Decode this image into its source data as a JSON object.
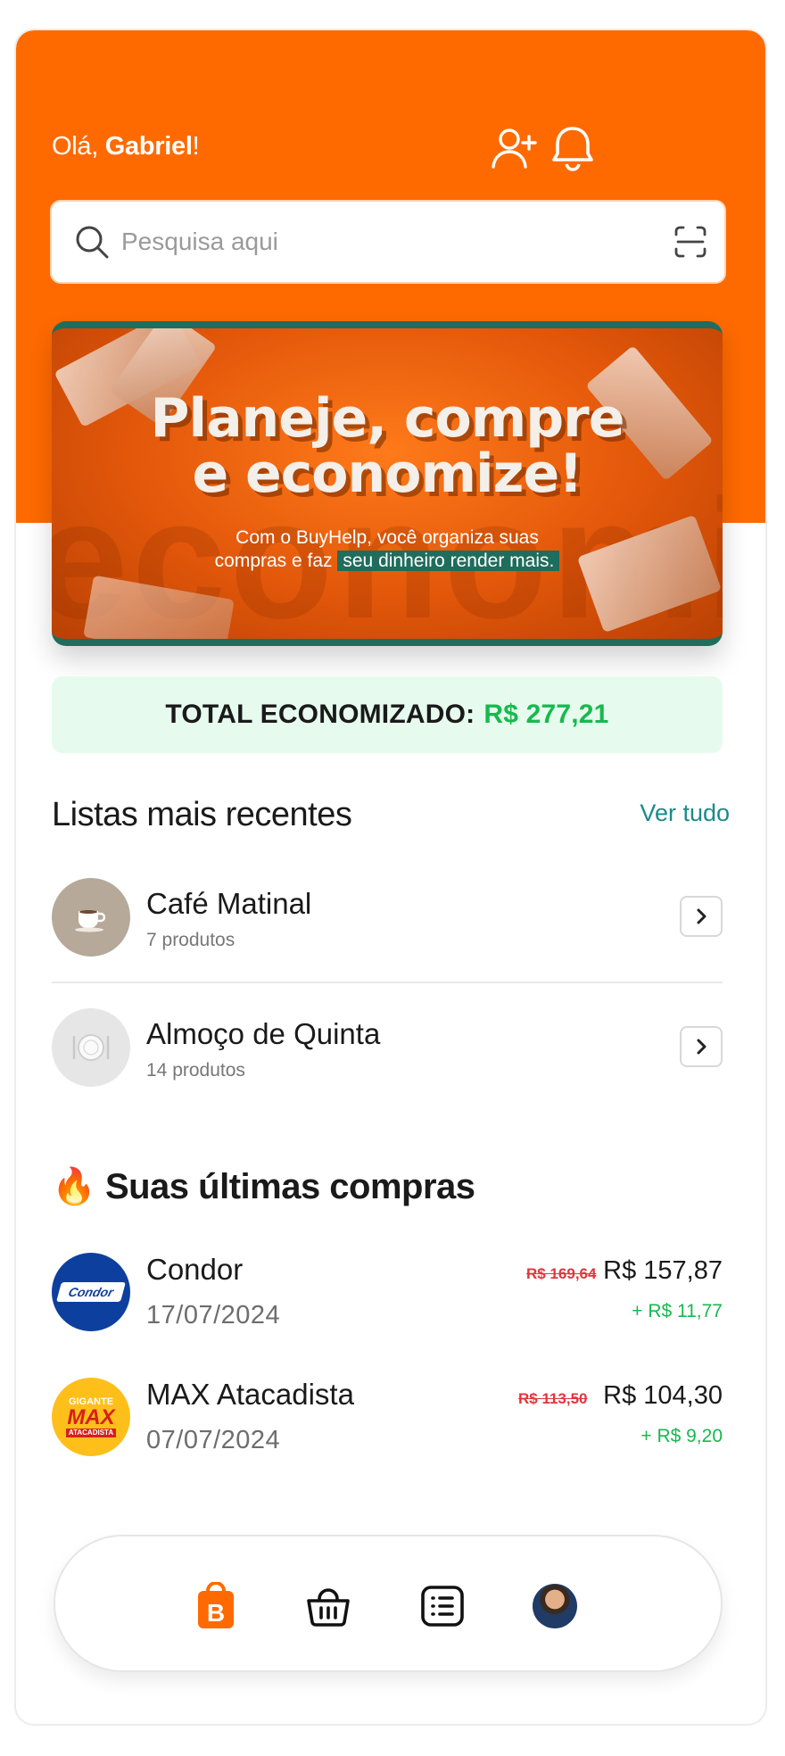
{
  "header": {
    "greeting_prefix": "Olá, ",
    "user_name": "Gabriel",
    "greeting_suffix": "!"
  },
  "search": {
    "placeholder": "Pesquisa aqui"
  },
  "banner": {
    "title_line1": "Planeje, compre",
    "title_line2": "e economize!",
    "subtitle_line1": "Com o BuyHelp, você organiza suas",
    "subtitle_line2_start": "compras e faz ",
    "subtitle_highlight": "seu dinheiro render mais.",
    "background_word": "economize"
  },
  "total": {
    "label": "TOTAL ECONOMIZADO:",
    "amount": "R$ 277,21"
  },
  "recent_lists": {
    "title": "Listas mais recentes",
    "see_all": "Ver tudo",
    "items": [
      {
        "name": "Café Matinal",
        "count": "7 produtos",
        "icon": "coffee-cup-icon"
      },
      {
        "name": "Almoço de Quinta",
        "count": "14 produtos",
        "icon": "plate-icon"
      }
    ]
  },
  "purchases": {
    "title_emoji": "🔥",
    "title": "Suas últimas compras",
    "items": [
      {
        "store": "Condor",
        "date": "17/07/2024",
        "old_price": "R$ 169,64",
        "price": "R$ 157,87",
        "saved": "+ R$ 11,77",
        "logo_text": "Condor"
      },
      {
        "store": "MAX Atacadista",
        "date": "07/07/2024",
        "old_price": "R$ 113,50",
        "price": "R$ 104,30",
        "saved": "+ R$ 9,20",
        "logo_top": "GIGANTE",
        "logo_main": "MAX",
        "logo_bottom": "ATACADISTA"
      }
    ]
  },
  "nav": {
    "items": [
      "home-bag-icon",
      "basket-icon",
      "list-icon",
      "profile-avatar"
    ]
  },
  "colors": {
    "brand_orange": "#ff6a00",
    "accent_teal": "#1b8a8a",
    "savings_green": "#19b84f",
    "strike_red": "#e0363c"
  }
}
